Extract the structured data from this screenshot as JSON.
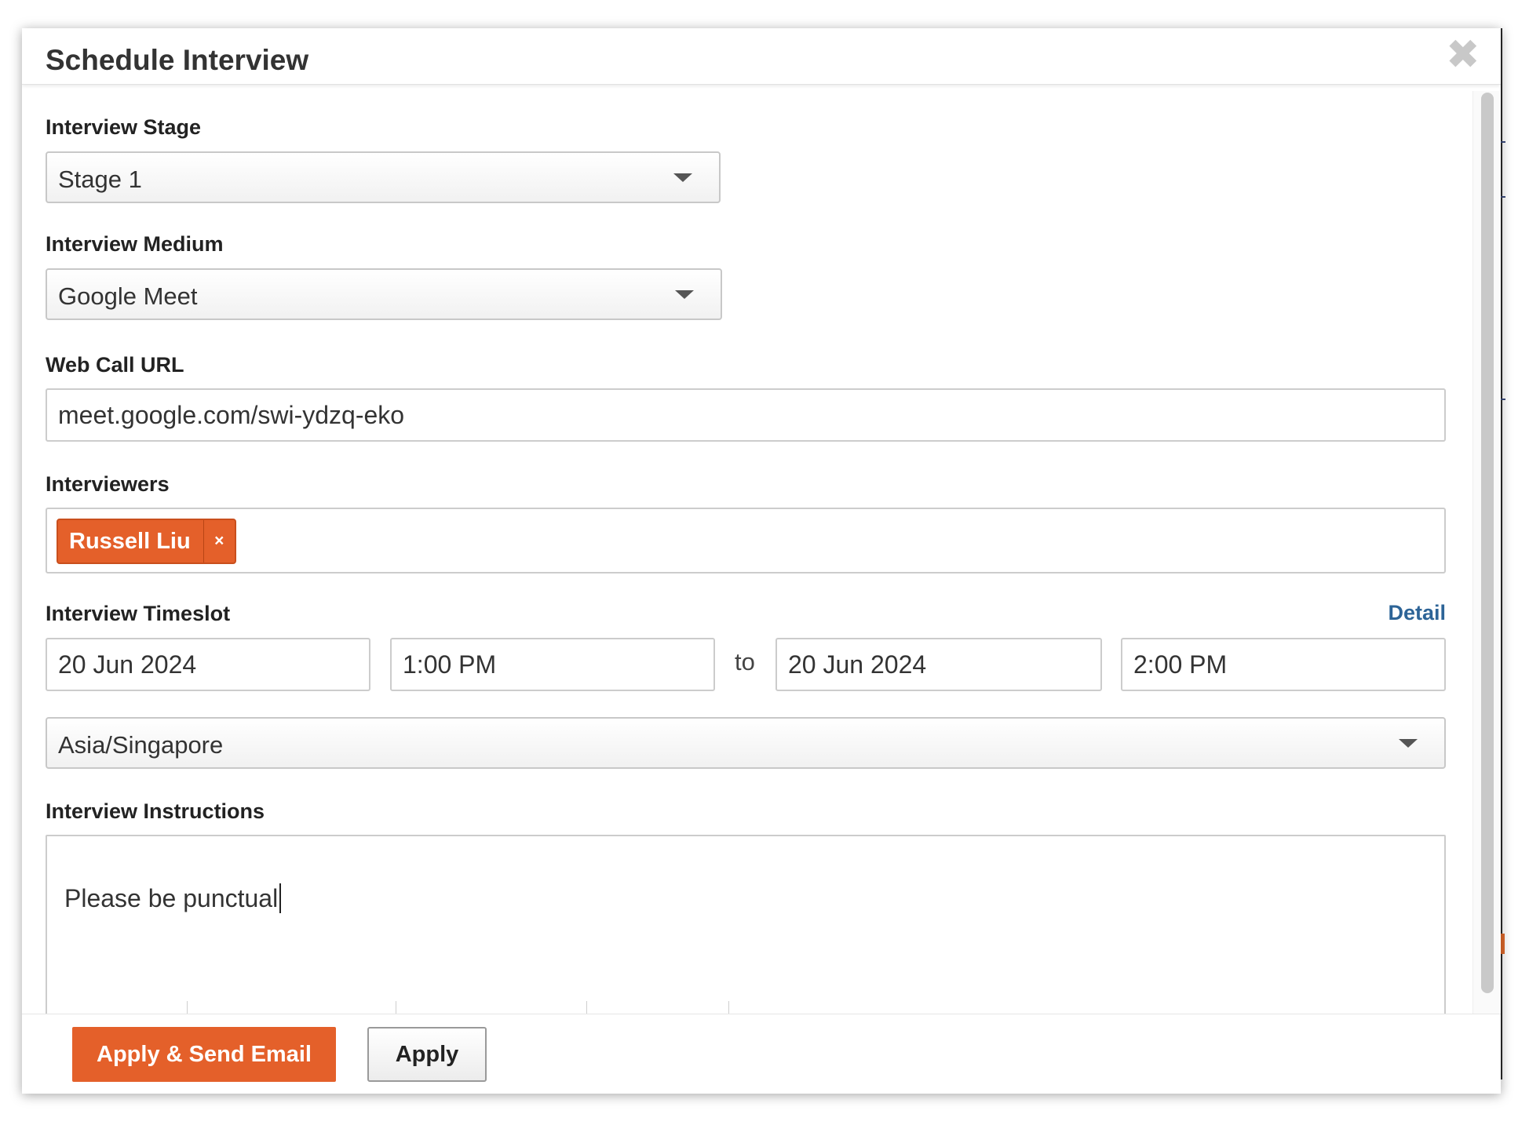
{
  "dialog": {
    "title": "Schedule Interview"
  },
  "fields": {
    "stage": {
      "label": "Interview Stage",
      "value": "Stage 1"
    },
    "medium": {
      "label": "Interview Medium",
      "value": "Google Meet"
    },
    "web_call_url": {
      "label": "Web Call URL",
      "value": "meet.google.com/swi-ydzq-eko"
    },
    "interviewers": {
      "label": "Interviewers",
      "tags": [
        {
          "name": "Russell Liu",
          "remove": "×"
        }
      ]
    },
    "timeslot": {
      "label": "Interview Timeslot",
      "detail_link": "Detail",
      "start_date": "20 Jun 2024",
      "start_time": "1:00 PM",
      "separator": "to",
      "end_date": "20 Jun 2024",
      "end_time": "2:00 PM",
      "timezone": "Asia/Singapore"
    },
    "instructions": {
      "label": "Interview Instructions",
      "value": "Please be punctual"
    }
  },
  "footer": {
    "primary_button": "Apply & Send Email",
    "secondary_button": "Apply"
  },
  "colors": {
    "accent": "#e4602a",
    "link": "#2d6497"
  }
}
